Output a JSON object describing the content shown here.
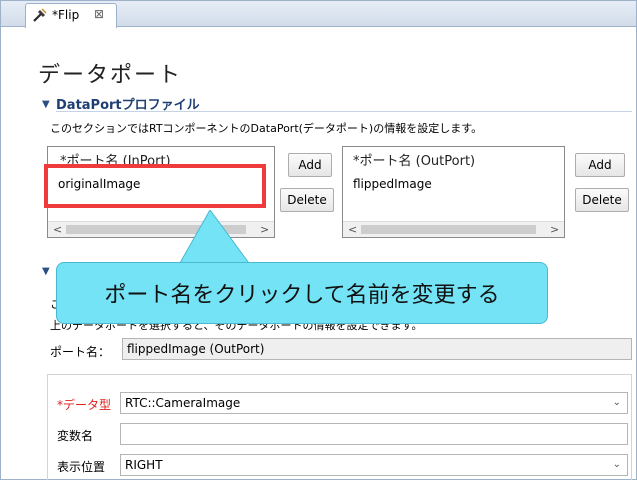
{
  "editor_tab": {
    "label": "*Flip",
    "close": "⊠",
    "icon": "rtc-builder-icon"
  },
  "page_title": "データポート",
  "section_dataport": {
    "title": "DataPortプロファイル",
    "twist": "▼",
    "description": "このセクションではRTコンポーネントのDataPort(データポート)の情報を設定します。"
  },
  "inport_list": {
    "header": "*ポート名 (InPort)",
    "items": [
      "originalImage"
    ]
  },
  "outport_list": {
    "header": "*ポート名 (OutPort)",
    "items": [
      "flippedImage"
    ]
  },
  "buttons": {
    "add": "Add",
    "delete": "Delete"
  },
  "scroll_arrows": {
    "left": "<",
    "right": ">"
  },
  "callout": {
    "text": "ポート名をクリックして名前を変更する"
  },
  "section_detail": {
    "twist": "▼",
    "desc_line1": "こ",
    "desc_line2": "上のデータポートを選択すると、そのデータポートの情報を設定できます。"
  },
  "port_name": {
    "label": "ポート名：",
    "value": "flippedImage (OutPort)"
  },
  "data_type": {
    "label": "*データ型",
    "value": "RTC::CameraImage",
    "color": "#e0201b"
  },
  "variable_name": {
    "label": "変数名",
    "value": ""
  },
  "display_position": {
    "label": "表示位置",
    "value": "RIGHT"
  },
  "colors": {
    "highlight": "#ef3b3b",
    "callout": "#73e3f5",
    "section_title": "#1f3f73"
  }
}
